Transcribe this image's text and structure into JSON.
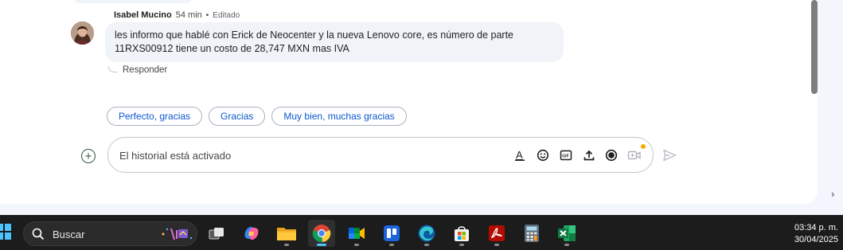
{
  "message": {
    "sender": "Isabel Mucino",
    "time": "54 min",
    "separator": "•",
    "edited": "Editado",
    "lines": [
      "les informo que hablé con Erick de Neocenter y la nueva  Lenovo core,  es número de parte",
      "11RXS00912 tiene un costo de 28,747 MXN mas IVA"
    ],
    "reply_label": "Responder"
  },
  "suggestions": [
    "Perfecto, gracias",
    "Gracias",
    "Muy bien, muchas gracias"
  ],
  "composer": {
    "placeholder": "El historial está activado",
    "tools": [
      "format-text-icon",
      "emoji-icon",
      "gif-icon",
      "upload-icon",
      "record-video-message-icon",
      "video-meeting-icon"
    ],
    "accent_dot_color": "#f9ab00"
  },
  "taskbar": {
    "search_label": "Buscar",
    "apps": [
      "task-view-icon",
      "copilot-icon",
      "file-explorer-icon",
      "chrome-icon",
      "google-meet-icon",
      "microsoft-todo-icon",
      "edge-icon",
      "microsoft-store-icon",
      "acrobat-icon",
      "calculator-icon",
      "excel-icon"
    ],
    "time": "03:34 p. m.",
    "date": "30/04/2025"
  },
  "colors": {
    "link_blue": "#0b57d0",
    "bubble_bg": "#f0f4f9",
    "taskbar_bg": "#1c1c1c",
    "active_indicator": "#4cc2ff"
  }
}
